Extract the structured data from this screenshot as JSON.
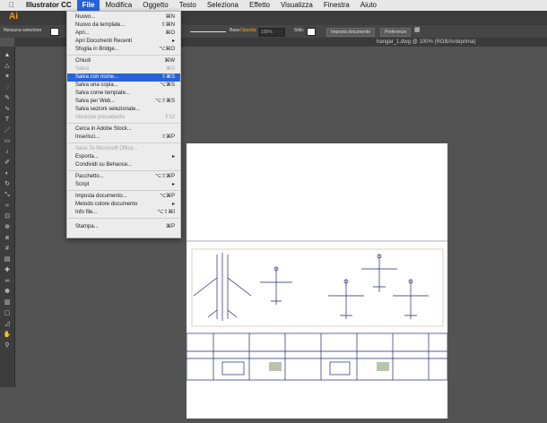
{
  "menubar": {
    "apple": "",
    "items": [
      "Illustrator CC",
      "File",
      "Modifica",
      "Oggetto",
      "Testo",
      "Seleziona",
      "Effetto",
      "Visualizza",
      "Finestra",
      "Aiuto"
    ]
  },
  "app_logo": "Ai",
  "control_bar": {
    "selection_label": "Nessuna selezione",
    "stroke_label": "Base",
    "opacity_label": "Opacità:",
    "opacity_value": "100%",
    "style_label": "Stile:",
    "doc_setup_button": "Imposta documento",
    "prefs_button": "Preferenze"
  },
  "document_tab": "hangar_1.dwg @ 100% (RGB/Anteprima)",
  "file_menu": {
    "items": [
      {
        "label": "Nuovo...",
        "shortcut": "⌘N"
      },
      {
        "label": "Nuovo da template...",
        "shortcut": "⇧⌘N"
      },
      {
        "label": "Apri...",
        "shortcut": "⌘O"
      },
      {
        "label": "Apri Documenti Recenti",
        "shortcut": "▸"
      },
      {
        "label": "Sfoglia in Bridge...",
        "shortcut": "⌥⌘O"
      },
      {
        "label": "Chiudi",
        "shortcut": "⌘W"
      },
      {
        "label": "Salva",
        "shortcut": "⌘S"
      },
      {
        "label": "Salva con nome...",
        "shortcut": "⇧⌘S"
      },
      {
        "label": "Salva una copia...",
        "shortcut": "⌥⌘S"
      },
      {
        "label": "Salva come template..."
      },
      {
        "label": "Salva per Web...",
        "shortcut": "⌥⇧⌘S"
      },
      {
        "label": "Salva sezioni selezionate..."
      },
      {
        "label": "Versione precedente",
        "shortcut": "F12"
      },
      {
        "label": "Cerca in Adobe Stock..."
      },
      {
        "label": "Inserisci...",
        "shortcut": "⇧⌘P"
      },
      {
        "label": "Save To Microsoft Office..."
      },
      {
        "label": "Esporta...",
        "shortcut": "▸"
      },
      {
        "label": "Condividi su Behance..."
      },
      {
        "label": "Pacchetto...",
        "shortcut": "⌥⇧⌘P"
      },
      {
        "label": "Script",
        "shortcut": "▸"
      },
      {
        "label": "Imposta documento...",
        "shortcut": "⌥⌘P"
      },
      {
        "label": "Metodo colore documento",
        "shortcut": "▸"
      },
      {
        "label": "Info file...",
        "shortcut": "⌥⇧⌘I"
      },
      {
        "label": "Stampa...",
        "shortcut": "⌘P"
      }
    ]
  },
  "toolbar_icons": [
    "selection-tool",
    "direct-selection-tool",
    "magic-wand-tool",
    "lasso-tool",
    "pen-tool",
    "curvature-tool",
    "type-tool",
    "line-tool",
    "rectangle-tool",
    "paintbrush-tool",
    "pencil-tool",
    "eraser-tool",
    "rotate-tool",
    "scale-tool",
    "width-tool",
    "free-transform-tool",
    "shape-builder-tool",
    "perspective-grid-tool",
    "mesh-tool",
    "gradient-tool",
    "eyedropper-tool",
    "blend-tool",
    "symbol-sprayer-tool",
    "column-graph-tool",
    "artboard-tool",
    "slice-tool",
    "hand-tool",
    "zoom-tool"
  ],
  "colors": {
    "menu_highlight": "#2a63d9",
    "workspace": "#535353",
    "artboard": "#ffffff",
    "drawing_lines": "#1f2a6b"
  }
}
